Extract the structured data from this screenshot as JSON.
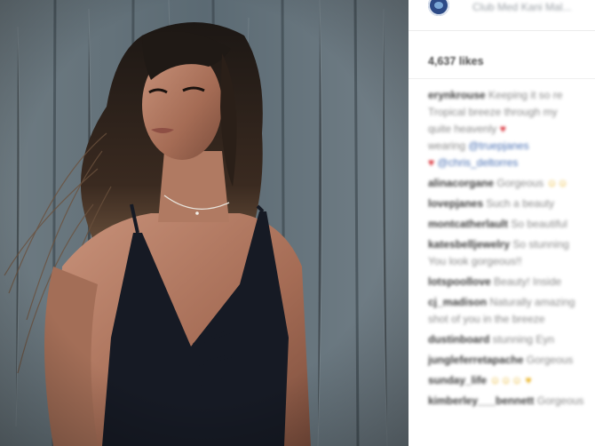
{
  "header": {
    "username": "Club Med Kani Mal..."
  },
  "post": {
    "likes_count": "4,637",
    "likes_word": "likes"
  },
  "comments": [
    {
      "user": "erynkrouse",
      "lines": [
        "Keeping it so re",
        "Tropical breeze through my",
        "quite heavenly"
      ],
      "emoji": "♥",
      "tail": "wearing",
      "tags": [
        "@truepjanes"
      ],
      "tags2": [
        "@chris_deltorres"
      ]
    },
    {
      "user": "alinacorgane",
      "text": "Gorgeous",
      "emoji_y": "☺☺"
    },
    {
      "user": "lovepjanes",
      "text": "Such a beauty"
    },
    {
      "user": "montcatherlault",
      "text": "So beautiful"
    },
    {
      "user": "katesbelljewelry",
      "text": "So stunning",
      "line2": "You look gorgeous!!"
    },
    {
      "user": "lotspoollove",
      "text": "Beauty! Inside"
    },
    {
      "user": "cj_madison",
      "text": "Naturally amazing",
      "line2": "shot of you in the breeze"
    },
    {
      "user": "dustinboard",
      "text": "stunning Eyn"
    },
    {
      "user": "jungleferretapache",
      "text": "Gorgeous"
    },
    {
      "user": "sunday_life",
      "emoji_y": "☺☺☺ ♥"
    },
    {
      "user": "kimberley___bennett",
      "text": "Gorgeous"
    }
  ],
  "colors": {
    "accent_blue": "#4b72b5",
    "heart_red": "#d9343c"
  },
  "icons": {
    "avatar": "globe-avatar-icon"
  }
}
